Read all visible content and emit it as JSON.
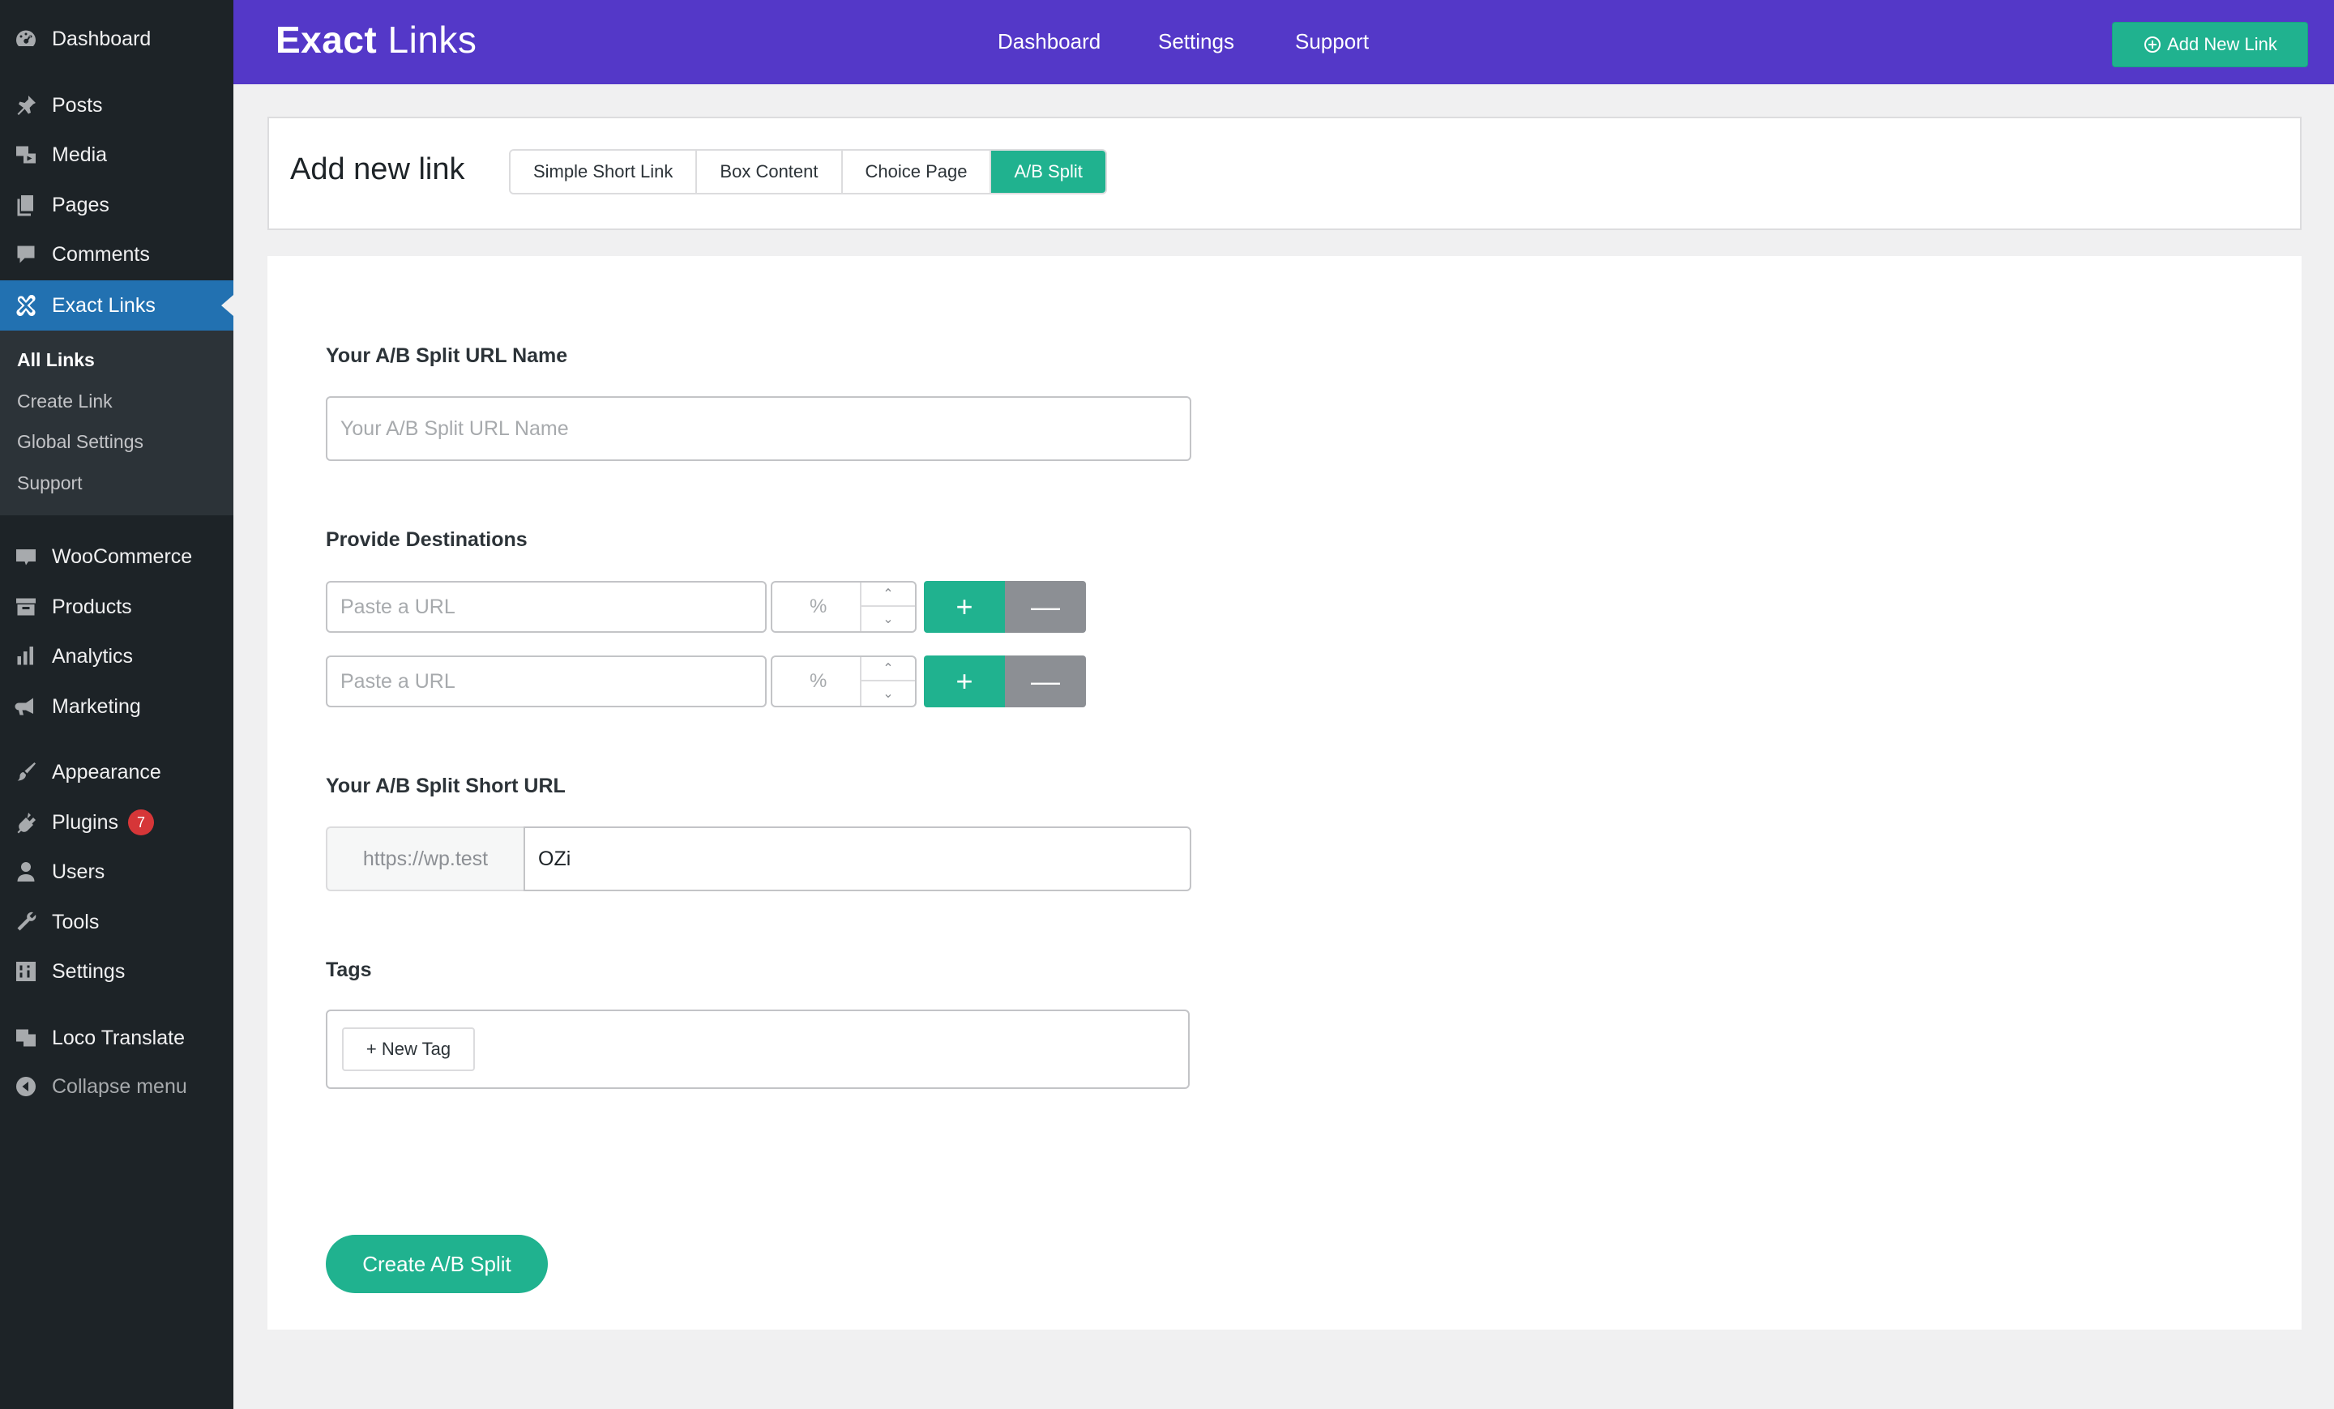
{
  "sidebar": {
    "items": [
      {
        "label": "Dashboard",
        "icon": "dashboard-icon"
      },
      {
        "label": "Posts",
        "icon": "pin-icon"
      },
      {
        "label": "Media",
        "icon": "media-icon"
      },
      {
        "label": "Pages",
        "icon": "pages-icon"
      },
      {
        "label": "Comments",
        "icon": "comment-icon"
      },
      {
        "label": "Exact Links",
        "icon": "exact-links-icon"
      },
      {
        "label": "WooCommerce",
        "icon": "woo-icon"
      },
      {
        "label": "Products",
        "icon": "archive-icon"
      },
      {
        "label": "Analytics",
        "icon": "chart-bar-icon"
      },
      {
        "label": "Marketing",
        "icon": "megaphone-icon"
      },
      {
        "label": "Appearance",
        "icon": "paintbrush-icon"
      },
      {
        "label": "Plugins",
        "icon": "plugin-icon",
        "badge": "7"
      },
      {
        "label": "Users",
        "icon": "user-icon"
      },
      {
        "label": "Tools",
        "icon": "wrench-icon"
      },
      {
        "label": "Settings",
        "icon": "settings-icon"
      },
      {
        "label": "Loco Translate",
        "icon": "translate-icon"
      },
      {
        "label": "Collapse menu",
        "icon": "collapse-icon"
      }
    ],
    "submenu": [
      "All Links",
      "Create Link",
      "Global Settings",
      "Support"
    ]
  },
  "topbar": {
    "logo_bold": "Exact",
    "logo_light": "Links",
    "nav": [
      "Dashboard",
      "Settings",
      "Support"
    ],
    "add_button": "Add New Link"
  },
  "header": {
    "title": "Add new link",
    "tabs": [
      "Simple Short Link",
      "Box Content",
      "Choice Page",
      "A/B Split"
    ],
    "selected_tab": "A/B Split"
  },
  "form": {
    "name_label": "Your A/B Split URL Name",
    "name_placeholder": "Your A/B Split URL Name",
    "destinations_label": "Provide Destinations",
    "destinations": [
      {
        "url_placeholder": "Paste a URL",
        "percent_placeholder": "%"
      },
      {
        "url_placeholder": "Paste a URL",
        "percent_placeholder": "%"
      }
    ],
    "add_symbol": "+",
    "remove_symbol": "—",
    "short_url_label": "Your A/B Split Short URL",
    "short_url_prefix": "https://wp.test",
    "short_url_slug": "OZi",
    "tags_label": "Tags",
    "new_tag_button": "+ New Tag",
    "submit_button": "Create A/B Split"
  },
  "colors": {
    "topbar": "#5438c8",
    "accent": "#20b28f",
    "sidebar": "#1d2327",
    "active_menu": "#2271b1",
    "badge": "#d63638"
  }
}
